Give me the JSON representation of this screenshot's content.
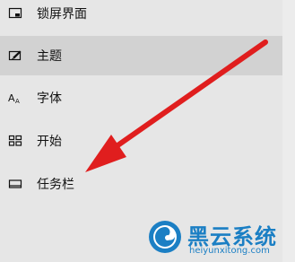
{
  "nav": {
    "items": [
      {
        "label": "锁屏界面",
        "icon": "lock-screen-icon",
        "selected": false
      },
      {
        "label": "主题",
        "icon": "theme-brush-icon",
        "selected": true
      },
      {
        "label": "字体",
        "icon": "font-icon",
        "selected": false
      },
      {
        "label": "开始",
        "icon": "start-tiles-icon",
        "selected": false
      },
      {
        "label": "任务栏",
        "icon": "taskbar-icon",
        "selected": false
      }
    ]
  },
  "annotation": {
    "arrow_color": "#e01e1e"
  },
  "watermark": {
    "title": "黑云系统",
    "url": "heiyunxitong.com",
    "color": "#1b7fc4"
  }
}
